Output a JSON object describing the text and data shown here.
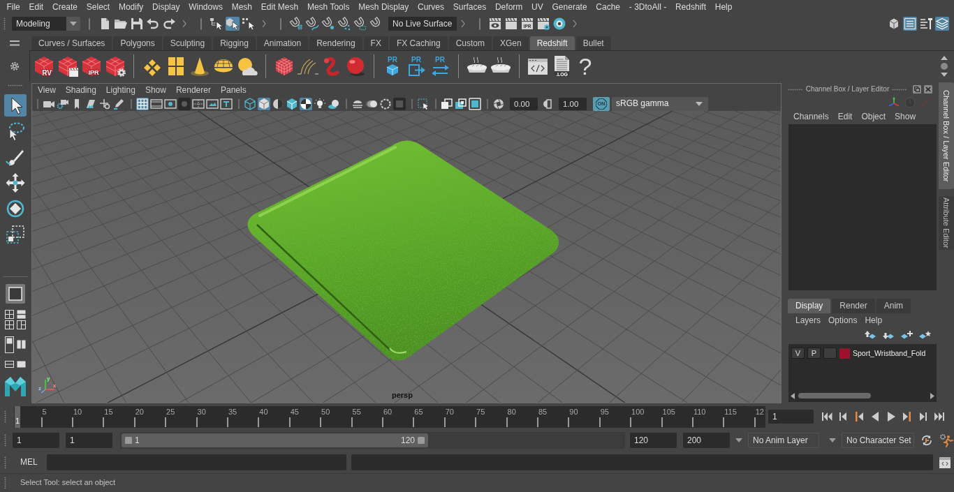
{
  "menu_bar": [
    "File",
    "Edit",
    "Create",
    "Select",
    "Modify",
    "Display",
    "Windows",
    "Mesh",
    "Edit Mesh",
    "Mesh Tools",
    "Mesh Display",
    "Curves",
    "Surfaces",
    "Deform",
    "UV",
    "Generate",
    "Cache",
    "- 3DtoAll -",
    "Redshift",
    "Help"
  ],
  "status_line": {
    "menu_set": "Modeling",
    "selection_modes": [
      {
        "selected": false
      },
      {
        "selected": true
      },
      {
        "selected": false
      }
    ],
    "live_surface": "No Live Surface",
    "ipr_label": "IPR",
    "panel_toggles": [
      {
        "selected": false
      },
      {
        "selected": true
      },
      {
        "selected": false
      },
      {
        "selected": true
      }
    ]
  },
  "shelf": {
    "tabs": [
      {
        "label": "Curves / Surfaces",
        "selected": false
      },
      {
        "label": "Polygons",
        "selected": false
      },
      {
        "label": "Sculpting",
        "selected": false
      },
      {
        "label": "Rigging",
        "selected": false
      },
      {
        "label": "Animation",
        "selected": false
      },
      {
        "label": "Rendering",
        "selected": false
      },
      {
        "label": "FX",
        "selected": false
      },
      {
        "label": "FX Caching",
        "selected": false
      },
      {
        "label": "Custom",
        "selected": false
      },
      {
        "label": "XGen",
        "selected": false
      },
      {
        "label": "Redshift",
        "selected": true
      },
      {
        "label": "Bullet",
        "selected": false
      }
    ],
    "rv_label": "RV",
    "ipr_label": "IPR",
    "pr_labels": [
      "PR",
      "PR",
      "PR"
    ],
    "log_label": ".LOG",
    "help_label": "?"
  },
  "toolbox": {
    "tools": [
      {
        "selected": true
      },
      {
        "selected": false
      },
      {
        "selected": false
      },
      {
        "selected": false
      },
      {
        "selected": false
      },
      {
        "selected": false
      }
    ],
    "layout": {
      "selected": true
    }
  },
  "viewport": {
    "menus": [
      "View",
      "Shading",
      "Lighting",
      "Show",
      "Renderer",
      "Panels"
    ],
    "gate_toggles": [
      {
        "selected": true
      },
      {
        "selected": false
      },
      {
        "selected": false
      },
      {
        "selected": false
      },
      {
        "selected": false
      },
      {
        "selected": false
      },
      {
        "selected": false
      }
    ],
    "shading_toggles": [
      {
        "selected": false
      },
      {
        "selected": true
      },
      {
        "selected": false
      },
      {
        "selected": false
      },
      {
        "selected": true
      },
      {
        "selected": false
      },
      {
        "selected": false
      }
    ],
    "exposure": "0.00",
    "gamma": "1.00",
    "color_management": {
      "label": "ON",
      "on": true
    },
    "color_space": "sRGB gamma",
    "axis_labels": [
      "y",
      "z",
      "x"
    ],
    "camera": "persp"
  },
  "channel_box": {
    "title": "Channel Box / Layer Editor",
    "menus": [
      "Channels",
      "Edit",
      "Object",
      "Show"
    ],
    "layer_tabs": [
      {
        "label": "Display",
        "selected": true
      },
      {
        "label": "Render",
        "selected": false
      },
      {
        "label": "Anim",
        "selected": false
      }
    ],
    "layer_menus": [
      "Layers",
      "Options",
      "Help"
    ],
    "layers": [
      {
        "visibility": "V",
        "playback": "P",
        "color": "#a0102a",
        "name": "Sport_Wristband_Fold"
      }
    ]
  },
  "side_tabs": [
    {
      "label": "Channel Box / Layer Editor",
      "selected": true
    },
    {
      "label": "Attribute Editor",
      "selected": false
    }
  ],
  "timeline": {
    "ticks": [
      "5",
      "10",
      "15",
      "20",
      "25",
      "30",
      "35",
      "40",
      "45",
      "50",
      "55",
      "60",
      "65",
      "70",
      "75",
      "80",
      "85",
      "90",
      "95",
      "100",
      "105",
      "110",
      "115",
      "12"
    ],
    "current_frame": "1",
    "level": 0,
    "frame_field": "1"
  },
  "range": {
    "start": "1",
    "playback_start": "1",
    "level": 0.61,
    "slider_start": "1",
    "slider_end": "120",
    "playback_end": "120",
    "end": "200",
    "anim_layer": "No Anim Layer",
    "character_set": "No Character Set"
  },
  "command_line": {
    "language": "MEL"
  },
  "help_line": "Select Tool: select an object"
}
